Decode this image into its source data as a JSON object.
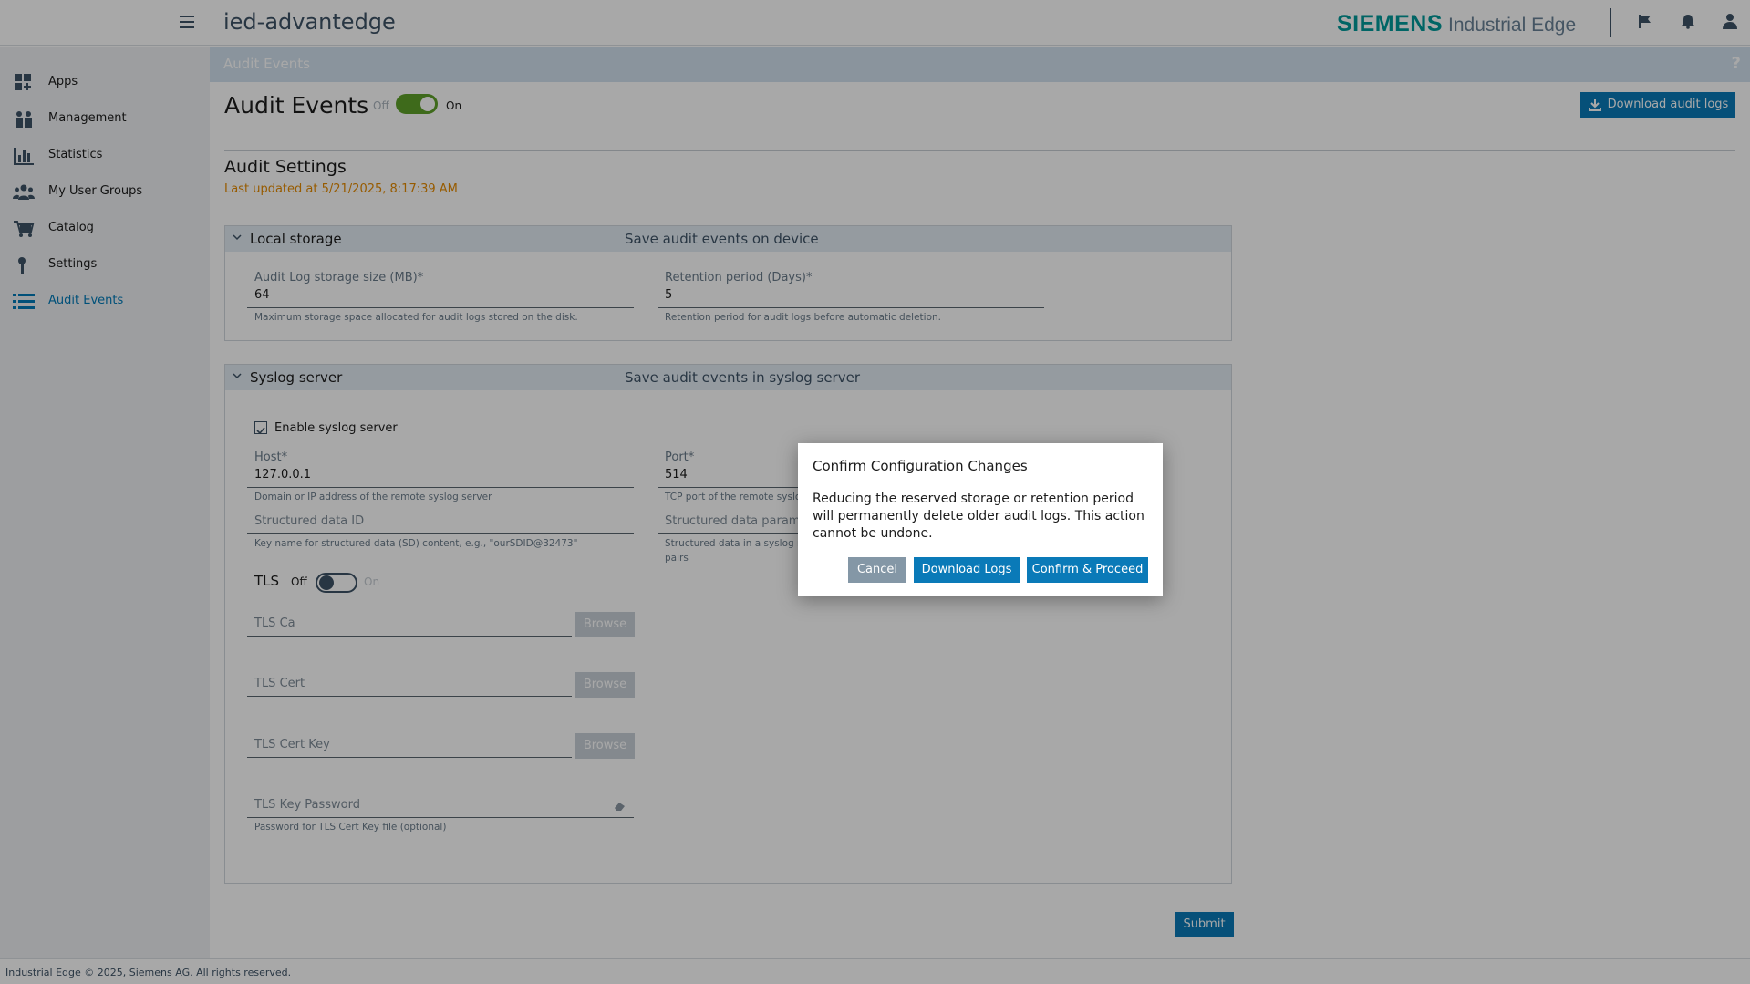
{
  "header": {
    "device_name": "ied-advantedge",
    "brand_siemens": "SIEMENS",
    "brand_product": "Industrial Edge"
  },
  "sidebar": {
    "items": [
      {
        "label": "Apps",
        "icon": "apps-grid-icon"
      },
      {
        "label": "Management",
        "icon": "management-users-icon"
      },
      {
        "label": "Statistics",
        "icon": "bar-chart-icon"
      },
      {
        "label": "My User Groups",
        "icon": "user-groups-icon"
      },
      {
        "label": "Catalog",
        "icon": "catalog-cart-icon"
      },
      {
        "label": "Settings",
        "icon": "wrench-icon"
      },
      {
        "label": "Audit Events",
        "icon": "list-icon",
        "active": true
      }
    ]
  },
  "breadcrumb": "Audit Events",
  "page": {
    "title": "Audit Events",
    "toggle_off": "Off",
    "toggle_on": "On",
    "download_button": "Download audit logs",
    "section_title": "Audit Settings",
    "last_updated": "Last updated at 5/21/2025, 8:17:39 AM"
  },
  "local_storage": {
    "title": "Local storage",
    "description": "Save audit events on device",
    "storage_size_label": "Audit Log storage size (MB)*",
    "storage_size_value": "64",
    "storage_size_hint": "Maximum storage space allocated for audit logs stored on the disk.",
    "retention_label": "Retention period (Days)*",
    "retention_value": "5",
    "retention_hint": "Retention period for audit logs before automatic deletion."
  },
  "syslog": {
    "title": "Syslog server",
    "description": "Save audit events in syslog server",
    "enable_label": "Enable syslog server",
    "enable_checked": true,
    "host_label": "Host*",
    "host_value": "127.0.0.1",
    "host_hint": "Domain or IP address of the remote syslog server",
    "port_label": "Port*",
    "port_value": "514",
    "port_hint": "TCP port of the remote syslo",
    "sd_id_placeholder": "Structured data ID",
    "sd_id_hint": "Key name for structured data (SD) content, e.g., \"ourSDID@32473\"",
    "sd_param_placeholder": "Structured data param",
    "sd_param_hint_line1": "Structured data in a syslog r",
    "sd_param_hint_line2": "pairs",
    "tls_label": "TLS",
    "tls_off": "Off",
    "tls_on": "On",
    "tls_ca_placeholder": "TLS Ca",
    "tls_cert_placeholder": "TLS Cert",
    "tls_cert_key_placeholder": "TLS Cert Key",
    "browse_label": "Browse",
    "tls_key_password_placeholder": "TLS Key Password",
    "tls_key_password_hint": "Password for TLS Cert Key file (optional)"
  },
  "submit_label": "Submit",
  "footer": "Industrial Edge © 2025, Siemens AG. All rights reserved.",
  "dialog": {
    "title": "Confirm Configuration Changes",
    "body": "Reducing the reserved storage or retention period will permanently delete older audit logs. This action cannot be undone.",
    "cancel": "Cancel",
    "download": "Download Logs",
    "confirm": "Confirm & Proceed"
  },
  "colors": {
    "accent": "#0a7ab8",
    "brand_teal": "#009999",
    "toggle_on": "#5fa12a",
    "warning_text": "#e58a00"
  }
}
